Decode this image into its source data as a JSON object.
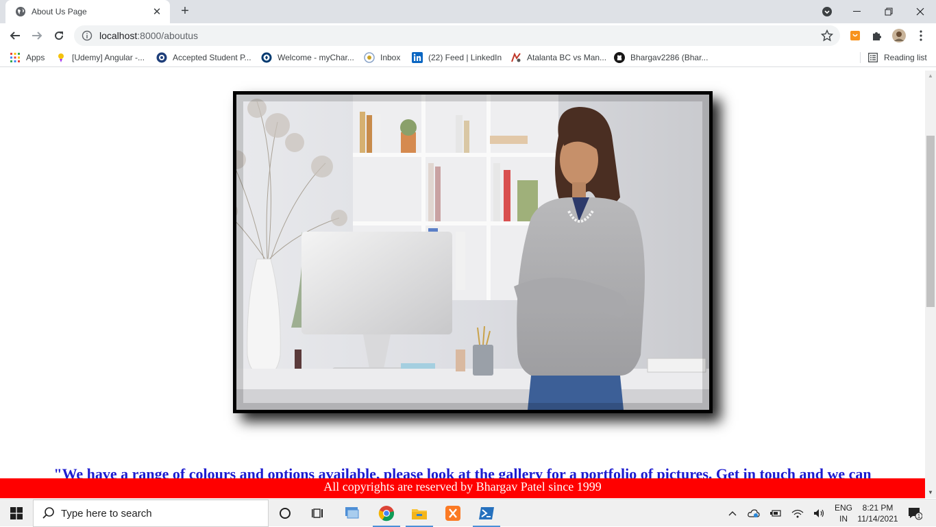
{
  "browser": {
    "tab_title": "About Us Page",
    "url_host": "localhost",
    "url_path": ":8000/aboutus",
    "bookmarks": [
      {
        "label": "Apps",
        "icon": "apps-grid-icon"
      },
      {
        "label": "[Udemy] Angular -...",
        "icon": "udemy-icon"
      },
      {
        "label": "Accepted Student P...",
        "icon": "university-seal-icon"
      },
      {
        "label": "Welcome - myChar...",
        "icon": "charlotte-icon"
      },
      {
        "label": "Inbox",
        "icon": "mail-icon"
      },
      {
        "label": "(22) Feed | LinkedIn",
        "icon": "linkedin-icon"
      },
      {
        "label": "Atalanta BC vs Man...",
        "icon": "football-icon"
      },
      {
        "label": "Bhargav2286 (Bhar...",
        "icon": "github-icon"
      }
    ],
    "reading_list": "Reading list"
  },
  "page": {
    "quote": "\"We have a range of colours and options available, please look at the gallery for a portfolio of pictures. Get in touch and we can",
    "footer": "All copyrights are reserved by Bhargav Patel since 1999",
    "photo_alt": "Woman standing in an office with arms crossed"
  },
  "taskbar": {
    "search_placeholder": "Type here to search",
    "lang_line1": "ENG",
    "lang_line2": "IN",
    "time": "8:21 PM",
    "date": "11/14/2021",
    "notification_count": "1"
  },
  "colors": {
    "quote": "#1c1ccf",
    "footer_bg": "#ff0000",
    "footer_text": "#ffffff"
  }
}
